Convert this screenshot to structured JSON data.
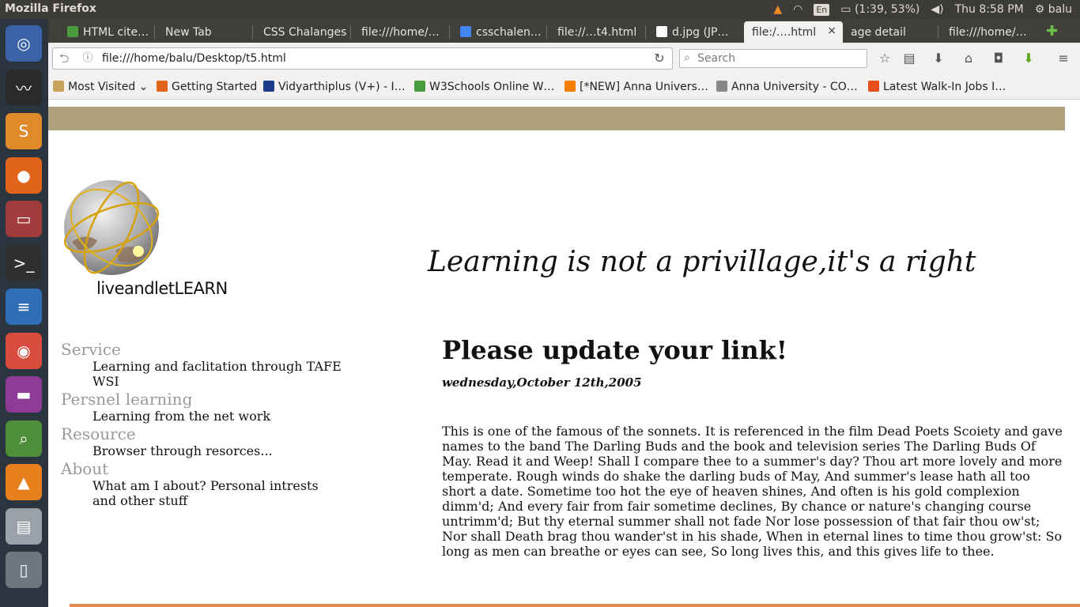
{
  "os": {
    "window_title": "Mozilla Firefox",
    "tray": {
      "lang": "En",
      "battery": "(1:39, 53%)",
      "clock": "Thu  8:58 PM",
      "user": "balu"
    }
  },
  "launcher": {
    "items": [
      {
        "name": "ubuntu-dash-icon",
        "glyph": "◎",
        "color": "#3a63a8"
      },
      {
        "name": "system-monitor-icon",
        "glyph": "〰",
        "color": "#2a2a2a"
      },
      {
        "name": "sublime-text-icon",
        "glyph": "S",
        "color": "#e08a2b"
      },
      {
        "name": "firefox-icon",
        "glyph": "●",
        "color": "#e2641b"
      },
      {
        "name": "files-icon",
        "glyph": "▭",
        "color": "#a23b3b"
      },
      {
        "name": "terminal-icon",
        "glyph": ">_",
        "color": "#2f2f2f"
      },
      {
        "name": "libreoffice-writer-icon",
        "glyph": "≡",
        "color": "#2f6db5"
      },
      {
        "name": "chrome-icon",
        "glyph": "◉",
        "color": "#d94c3d"
      },
      {
        "name": "app-window-icon",
        "glyph": "▬",
        "color": "#8e3b96"
      },
      {
        "name": "image-viewer-icon",
        "glyph": "⌕",
        "color": "#4e8e3a"
      },
      {
        "name": "vlc-icon",
        "glyph": "▲",
        "color": "#e87e1c"
      },
      {
        "name": "disk-icon",
        "glyph": "▤",
        "color": "#9aa1a8"
      },
      {
        "name": "devices-icon",
        "glyph": "▯",
        "color": "#6d7780"
      }
    ]
  },
  "tabs": [
    {
      "label": "HTML cite…",
      "fav": "#4a9a3e"
    },
    {
      "label": "New Tab",
      "fav": ""
    },
    {
      "label": "CSS Chalanges",
      "fav": ""
    },
    {
      "label": "file:///home/…",
      "fav": ""
    },
    {
      "label": "csschalen…",
      "fav": "#4285f4"
    },
    {
      "label": "file://…t4.html",
      "fav": ""
    },
    {
      "label": "d.jpg (JP…",
      "fav": "#ffffff"
    },
    {
      "label": "file:/….html",
      "fav": "",
      "active": true
    },
    {
      "label": "age detail",
      "fav": ""
    },
    {
      "label": "file:///home/…",
      "fav": ""
    }
  ],
  "toolbar": {
    "url": "file:///home/balu/Desktop/t5.html",
    "search_placeholder": "Search"
  },
  "bookmarks": [
    {
      "label": "Most Visited",
      "color": "#c7a35a",
      "dropdown": true
    },
    {
      "label": "Getting Started",
      "color": "#e2641b"
    },
    {
      "label": "Vidyarthiplus (V+) - I…",
      "color": "#1c3b8a"
    },
    {
      "label": "W3Schools Online W…",
      "color": "#4a9a3e"
    },
    {
      "label": "[*NEW] Anna Univers…",
      "color": "#f57d00"
    },
    {
      "label": "Anna University - CO…",
      "color": "#888888"
    },
    {
      "label": "Latest Walk-In Jobs I…",
      "color": "#e84e1b"
    }
  ],
  "content": {
    "logo_text": "liveandletLEARN",
    "motto": "Learning is not a privillage,it's a right",
    "nav": [
      {
        "heading": "Service",
        "desc": "Learning and faclitation through TAFE WSI"
      },
      {
        "heading": "Persnel learning",
        "desc": "Learning from the net work"
      },
      {
        "heading": "Resource",
        "desc": "Browser through resorces..."
      },
      {
        "heading": "About",
        "desc": "What am I about? Personal intrests and other stuff"
      }
    ],
    "heading": "Please update your link!",
    "date": "wednesday,October 12th,2005",
    "body": "This is one of the famous of the sonnets. It is referenced in the film Dead Poets Scoiety and gave names to the band The Darling Buds and the book and television series The Darling Buds Of May. Read it and Weep! Shall I compare thee to a summer's day? Thou art more lovely and more temperate. Rough winds do shake the darling buds of May, And summer's lease hath all too short a date. Sometime too hot the eye of heaven shines, And often is his gold complexion dimm'd; And every fair from fair sometime declines, By chance or nature's changing course untrimm'd; But thy eternal summer shall not fade Nor lose possession of that fair thou ow'st; Nor shall Death brag thou wander'st in his shade, When in eternal lines to time thou grow'st: So long as men can breathe or eyes can see, So long lives this, and this gives life to thee."
  },
  "colors": {
    "banner": "#b1a27f",
    "nav_heading": "#999999",
    "footer_line": "#e38b57"
  }
}
